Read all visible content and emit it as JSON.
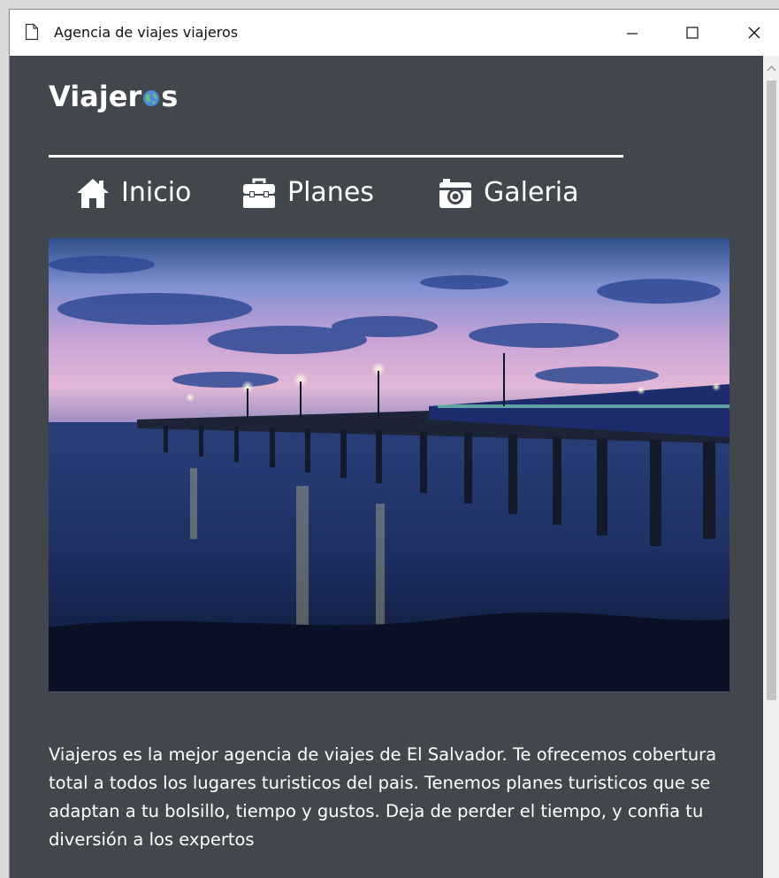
{
  "window": {
    "title": "Agencia de viajes viajeros",
    "controls": [
      "minimize-icon",
      "maximize-icon",
      "close-icon"
    ]
  },
  "header": {
    "logo_prefix": "Viajer",
    "logo_suffix": "s",
    "logo_glyph": "globe-icon"
  },
  "nav": {
    "items": [
      {
        "label": "Inicio",
        "icon": "home-icon"
      },
      {
        "label": "Planes",
        "icon": "toolbox-icon"
      },
      {
        "label": "Galeria",
        "icon": "camera-icon"
      }
    ]
  },
  "hero": {
    "alt": "pier-at-dusk-photo"
  },
  "content": {
    "description": "Viajeros es la mejor agencia de viajes de El Salvador. Te ofrecemos cobertura total a todos los lugares turisticos del pais. Tenemos planes turisticos que se adaptan a tu bolsillo, tiempo y gustos. Deja de perder el tiempo, y confia tu diversión a los expertos"
  },
  "colors": {
    "page_bg": "#42474d",
    "text": "#ffffff",
    "globe_green": "#6fbf73",
    "globe_blue": "#4b8bd6"
  }
}
